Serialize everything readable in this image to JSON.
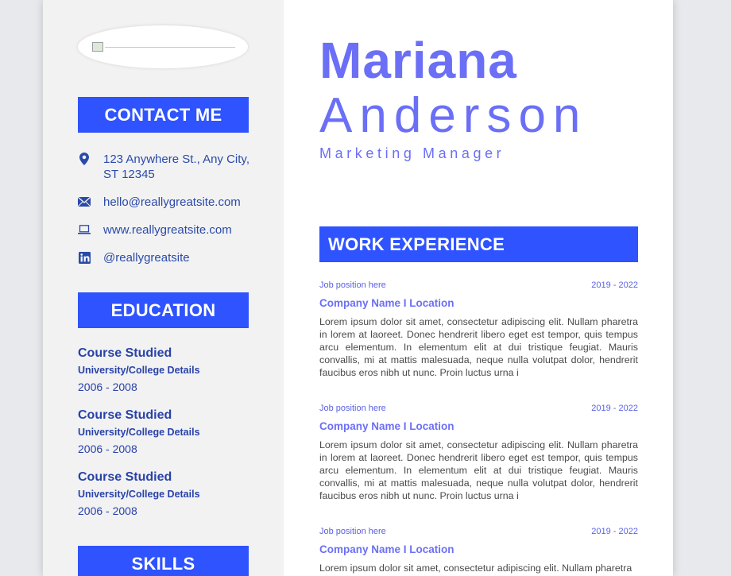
{
  "name": {
    "first": "Mariana",
    "last": "Anderson",
    "title": "Marketing Manager"
  },
  "sidebar": {
    "contact_heading": "CONTACT ME",
    "contact": [
      {
        "icon": "location-pin-icon",
        "text": "123 Anywhere St., Any City, ST 12345"
      },
      {
        "icon": "envelope-icon",
        "text": "hello@reallygreatsite.com"
      },
      {
        "icon": "laptop-icon",
        "text": "www.reallygreatsite.com"
      },
      {
        "icon": "linkedin-icon",
        "text": "@reallygreatsite"
      }
    ],
    "education_heading": "EDUCATION",
    "education": [
      {
        "course": "Course Studied",
        "university": "University/College Details",
        "years": "2006 - 2008"
      },
      {
        "course": "Course Studied",
        "university": "University/College Details",
        "years": "2006 - 2008"
      },
      {
        "course": "Course Studied",
        "university": "University/College Details",
        "years": "2006 - 2008"
      }
    ],
    "skills_heading": "SKILLS"
  },
  "work": {
    "heading": "WORK EXPERIENCE",
    "jobs": [
      {
        "position": "Job position here",
        "dates": "2019 - 2022",
        "company": "Company Name I Location",
        "description": "Lorem ipsum dolor sit amet, consectetur adipiscing elit. Nullam pharetra in lorem at laoreet. Donec hendrerit libero eget est tempor, quis tempus arcu elementum. In elementum elit at dui tristique feugiat. Mauris convallis, mi at mattis malesuada, neque nulla volutpat dolor, hendrerit faucibus eros nibh ut nunc. Proin luctus urna i"
      },
      {
        "position": "Job position here",
        "dates": "2019 - 2022",
        "company": "Company Name I Location",
        "description": "Lorem ipsum dolor sit amet, consectetur adipiscing elit. Nullam pharetra in lorem at laoreet. Donec hendrerit libero eget est tempor, quis tempus arcu elementum. In elementum elit at dui tristique feugiat. Mauris convallis, mi at mattis malesuada, neque nulla volutpat dolor, hendrerit faucibus eros nibh ut nunc. Proin luctus urna i"
      },
      {
        "position": "Job position here",
        "dates": "2019 - 2022",
        "company": "Company Name I Location",
        "description": "Lorem ipsum dolor sit amet, consectetur adipiscing elit. Nullam pharetra"
      }
    ]
  },
  "colors": {
    "accent": "#2e53ff",
    "name": "#6b6ff6",
    "sidebar_text": "#2a4aa8",
    "sidebar_bg": "#f2f2f3"
  }
}
